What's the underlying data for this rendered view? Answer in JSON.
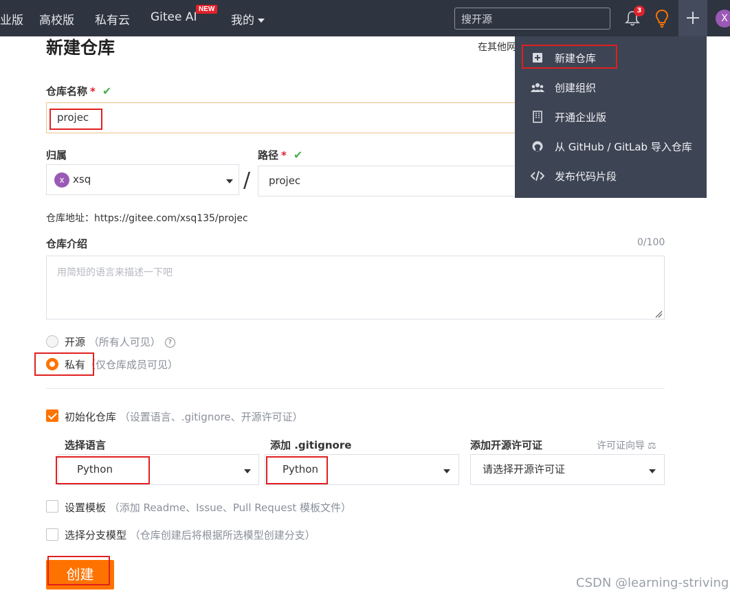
{
  "nav": {
    "items": [
      {
        "label": "业版"
      },
      {
        "label": "高校版"
      },
      {
        "label": "私有云"
      },
      {
        "label": "Gitee AI"
      },
      {
        "label": "我的"
      }
    ],
    "new_badge": "NEW",
    "search_placeholder": "搜开源",
    "notification_count": "3",
    "avatar_letter": "X"
  },
  "dropdown": {
    "items": [
      {
        "label": "新建仓库",
        "icon": "plus-square-icon"
      },
      {
        "label": "创建组织",
        "icon": "group-icon"
      },
      {
        "label": "开通企业版",
        "icon": "building-icon"
      },
      {
        "label": "从 GitHub / GitLab 导入仓库",
        "icon": "github-icon"
      },
      {
        "label": "发布代码片段",
        "icon": "code-icon"
      }
    ]
  },
  "form": {
    "title": "新建仓库",
    "other_link": "在其他网",
    "repo_name_label": "仓库名称",
    "required_mark": "*",
    "repo_name_value": "projec",
    "owner_label": "归属",
    "owner_avatar": "x",
    "owner_value": "xsq",
    "path_label": "路径",
    "path_value": "projec",
    "repo_address_label": "仓库地址：",
    "repo_address_value": "https://gitee.com/xsq135/projec",
    "intro_label": "仓库介绍",
    "intro_count": "0/100",
    "intro_placeholder": "用简短的语言来描述一下吧",
    "visibility": {
      "public_label": "开源",
      "public_hint": "（所有人可见）",
      "private_label": "私有",
      "private_hint": "（仅仓库成员可见）",
      "selected": "private"
    },
    "init_repo_label": "初始化仓库",
    "init_repo_hint": "（设置语言、.gitignore、开源许可证）",
    "init_repo_checked": true,
    "language_label": "选择语言",
    "language_value": "Python",
    "gitignore_label": "添加 .gitignore",
    "gitignore_value": "Python",
    "license_label": "添加开源许可证",
    "license_guide": "许可证向导",
    "license_placeholder": "请选择开源许可证",
    "template_label": "设置模板",
    "template_hint": "（添加 Readme、Issue、Pull Request 模板文件）",
    "template_checked": false,
    "branch_label": "选择分支模型",
    "branch_hint": "（仓库创建后将根据所选模型创建分支）",
    "branch_checked": false,
    "create_button": "创建"
  },
  "watermark": "CSDN @learning-striving",
  "colors": {
    "accent": "#fe7300",
    "nav_bg": "#2e3440",
    "dropdown_bg": "#3d4454",
    "highlight_box": "#e02020",
    "check_green": "#4caf50"
  }
}
